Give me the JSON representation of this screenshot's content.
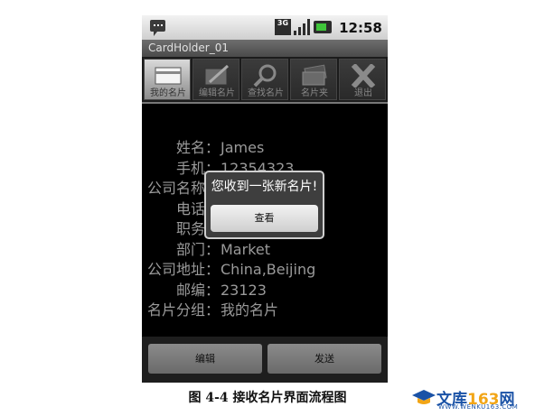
{
  "status_bar": {
    "network": "3G",
    "time": "12:58 PM"
  },
  "app_title": "CardHolder_01",
  "tabs": [
    {
      "label": "我的名片",
      "icon": "card-icon",
      "active": true
    },
    {
      "label": "编辑名片",
      "icon": "edit-icon",
      "active": false
    },
    {
      "label": "查找名片",
      "icon": "search-icon",
      "active": false
    },
    {
      "label": "名片夹",
      "icon": "cards-icon",
      "active": false
    },
    {
      "label": "退出",
      "icon": "close-icon",
      "active": false
    }
  ],
  "fields": [
    {
      "key": "姓名",
      "value": "James"
    },
    {
      "key": "手机",
      "value": "12354323"
    },
    {
      "key": "公司名称",
      "value": ""
    },
    {
      "key": "电话",
      "value": ""
    },
    {
      "key": "职务",
      "value": ""
    },
    {
      "key": "部门",
      "value": "Market"
    },
    {
      "key": "公司地址",
      "value": "China,Beijing"
    },
    {
      "key": "邮编",
      "value": "23123"
    },
    {
      "key": "名片分组",
      "value": "我的名片"
    }
  ],
  "separator": "：",
  "dialog": {
    "message": "您收到一张新名片!",
    "button": "查看"
  },
  "buttons": {
    "edit": "编辑",
    "send": "发送"
  },
  "caption": "图 4-4 接收名片界面流程图",
  "watermark": {
    "brand_text": "文库",
    "brand_number": "163",
    "brand_suffix": "网",
    "url": "WWW.WENKU163.COM"
  }
}
